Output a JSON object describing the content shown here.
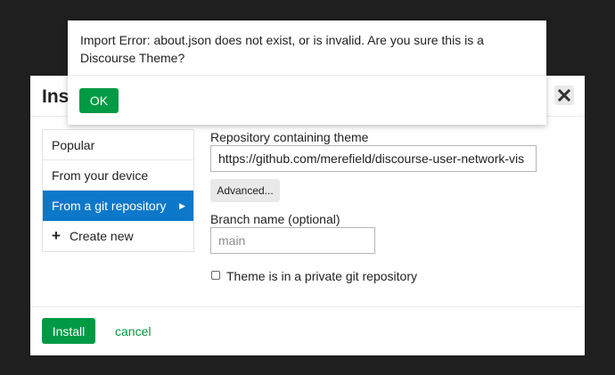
{
  "modal": {
    "title": "Ins",
    "close_icon": "close-icon",
    "nav": [
      {
        "label": "Popular",
        "active": false
      },
      {
        "label": "From your device",
        "active": false
      },
      {
        "label": "From a git repository",
        "active": true
      },
      {
        "label": "Create new",
        "active": false,
        "icon": "plus-icon"
      }
    ],
    "repo_label": "Repository containing theme",
    "repo_value": "https://github.com/merefield/discourse-user-network-vis",
    "advanced_label": "Advanced...",
    "branch_label": "Branch name (optional)",
    "branch_placeholder": "main",
    "branch_value": "",
    "private_label": "Theme is in a private git repository",
    "private_checked": false,
    "install_label": "Install",
    "cancel_label": "cancel"
  },
  "dialog": {
    "message": "Import Error: about.json does not exist, or is invalid. Are you sure this is a Discourse Theme?",
    "ok_label": "OK"
  },
  "colors": {
    "primary_green": "#009a44",
    "active_blue": "#0b78c9",
    "backdrop": "#1f1f1f"
  }
}
